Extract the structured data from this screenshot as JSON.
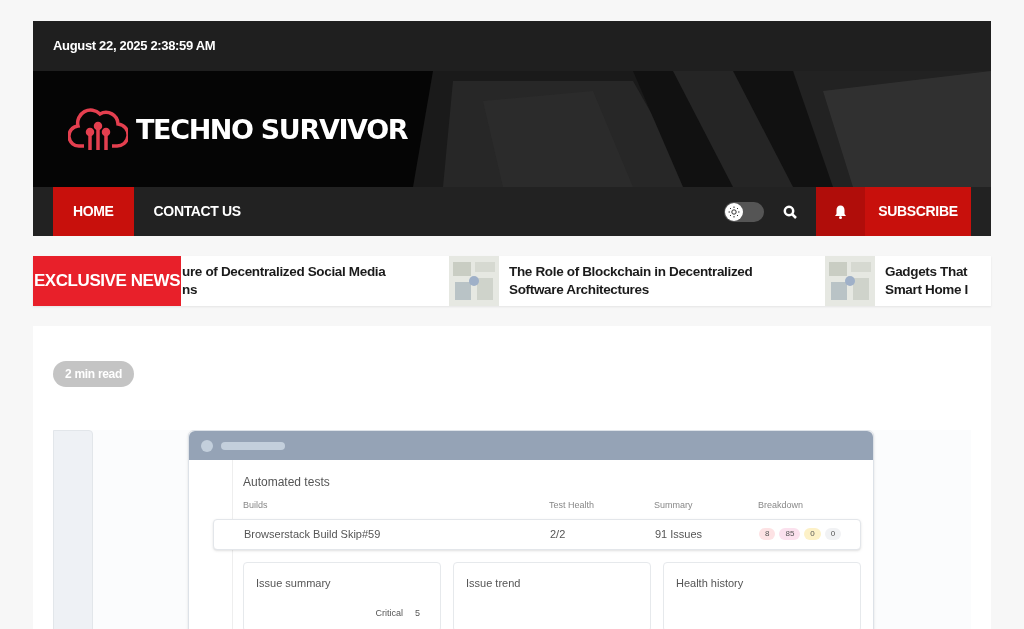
{
  "top_bar": {
    "datetime": "August 22, 2025 2:38:59 AM"
  },
  "header": {
    "site_name": "TECHNO SURVIVOR"
  },
  "nav": {
    "items": [
      {
        "label": "HOME",
        "selected": true
      },
      {
        "label": "CONTACT US",
        "selected": false
      }
    ],
    "dark_mode": {
      "on": false
    },
    "subscribe": "SUBSCRIBE"
  },
  "ticker": {
    "label": "EXCLUSIVE NEWS",
    "items": [
      {
        "thumbnail": false,
        "lines": [
          "ure of Decentralized Social Media",
          "ns"
        ]
      },
      {
        "thumbnail": true,
        "lines": [
          "The Role of Blockchain in Decentralized",
          "Software Architectures"
        ]
      },
      {
        "thumbnail": true,
        "lines": [
          "Gadgets That",
          "Smart Home I"
        ]
      }
    ]
  },
  "article": {
    "read_time": "2 min read",
    "featured_image": {
      "heading": "Automated tests",
      "columns": [
        "Builds",
        "Test Health",
        "Summary",
        "Breakdown"
      ],
      "build": {
        "name": "Browserstack Build Skip#59",
        "health": "2/2",
        "summary": "91 Issues",
        "breakdown": [
          {
            "value": "8",
            "color": "#fde2e4"
          },
          {
            "value": "85",
            "color": "#fbe1ee"
          },
          {
            "value": "0",
            "color": "#fdf1c7"
          },
          {
            "value": "0",
            "color": "#f1f2f4"
          }
        ]
      },
      "panels": [
        "Issue summary",
        "Issue trend",
        "Health history"
      ],
      "legend": {
        "label": "Critical",
        "value": "5"
      }
    }
  }
}
